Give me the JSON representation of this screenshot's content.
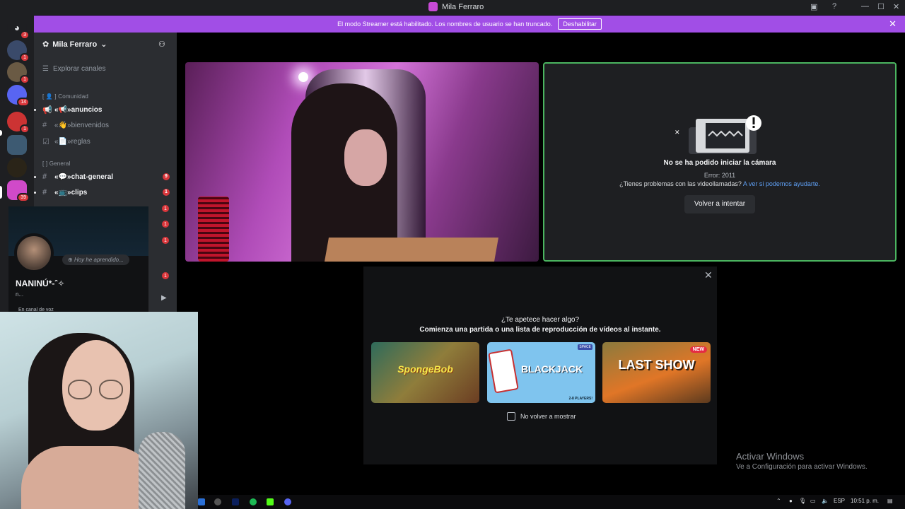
{
  "window": {
    "title": "Mila Ferraro"
  },
  "banner": {
    "text": "El modo Streamer está habilitado. Los nombres de usuario se han truncado.",
    "button": "Deshabilitar"
  },
  "rail": {
    "badges": [
      "3",
      "1",
      "1",
      "14",
      "1",
      "39"
    ]
  },
  "sidebar": {
    "server_name": "Mila Ferraro",
    "explore": "Explorar canales",
    "categories": {
      "community": "[ 👤 ] Comunidad",
      "general": "[ ] General"
    },
    "channels": [
      {
        "label": "«📢»anuncios"
      },
      {
        "label": "«👋»bienvenidos"
      },
      {
        "label": "«📄»reglas"
      },
      {
        "label": "«💬»chat-general",
        "badge": "9"
      },
      {
        "label": "«📺»clips",
        "badge": "1"
      }
    ],
    "extra_badges": [
      "1",
      "1",
      "1",
      "1"
    ]
  },
  "popout": {
    "status": "Hoy he aprendido...",
    "name": "NANINÚ*-ˆ✧",
    "sub": "n...",
    "voice": "En canal de voz"
  },
  "camera_error": {
    "title": "No se ha podido iniciar la cámara",
    "code": "Error: 2011",
    "help_prefix": "¿Tienes problemas con las videollamadas?",
    "help_link": "A ver si podemos ayudarte.",
    "retry": "Volver a intentar"
  },
  "activity": {
    "question": "¿Te apetece hacer algo?",
    "subtitle": "Comienza una partida o una lista de reproducción de vídeos al instante.",
    "cards": [
      {
        "title": "SpongeBob"
      },
      {
        "title": "BLACKJACK",
        "tag": "SPACE",
        "players": "2-8 PLAYERS!"
      },
      {
        "title": "LAST SHOW",
        "badge": "NEW"
      }
    ],
    "checkbox": "No volver a mostrar"
  },
  "activate_windows": {
    "title": "Activar Windows",
    "subtitle": "Ve a Configuración para activar Windows."
  },
  "taskbar": {
    "lang": "ESP",
    "time": "10:51 p. m."
  },
  "colors": {
    "accent": "#a14ee6",
    "badge": "#da373c",
    "camera_border": "#4bb560",
    "link": "#5fa0f5"
  }
}
